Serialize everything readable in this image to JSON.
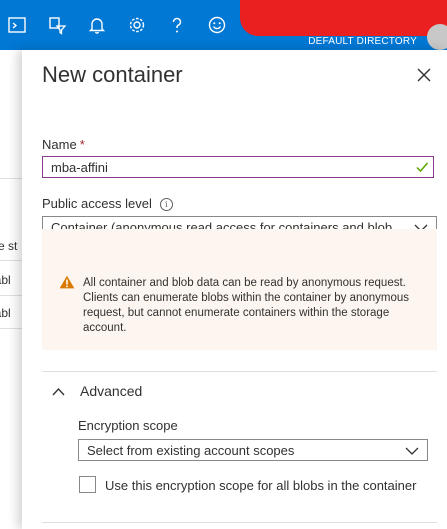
{
  "topbar": {
    "icons": [
      "cloud-shell-icon",
      "directory-filter-icon",
      "notifications-bell-icon",
      "settings-gear-icon",
      "help-question-icon",
      "feedback-smiley-icon"
    ],
    "directory_label": "DEFAULT DIRECTORY",
    "background_color": "#0078d4",
    "redaction_color": "#ea1f1f"
  },
  "background_blade": {
    "fragments": [
      "se st",
      "labl",
      "labl"
    ]
  },
  "panel": {
    "title": "New container",
    "name_field": {
      "label": "Name",
      "required_marker": "*",
      "value": "mba-affini"
    },
    "access_level": {
      "label": "Public access level",
      "selected": "Container (anonymous read access for containers and blob..."
    },
    "warning": {
      "text": "All container and blob data can be read by anonymous request. Clients can enumerate blobs within the container by anonymous request, but cannot enumerate containers within the storage account."
    },
    "advanced": {
      "label": "Advanced",
      "expanded": true,
      "encryption_scope": {
        "label": "Encryption scope",
        "placeholder": "Select from existing account scopes"
      },
      "checkbox": {
        "label": "Use this encryption scope for all blobs in the container",
        "checked": false
      }
    }
  }
}
